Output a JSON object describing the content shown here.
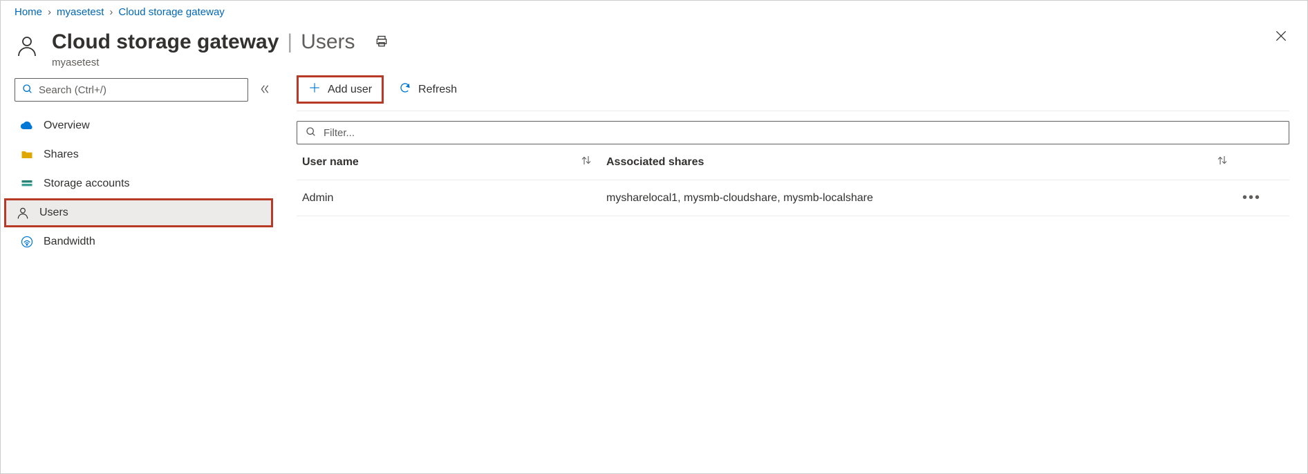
{
  "breadcrumb": [
    {
      "label": "Home"
    },
    {
      "label": "myasetest"
    },
    {
      "label": "Cloud storage gateway"
    }
  ],
  "header": {
    "title": "Cloud storage gateway",
    "section": "Users",
    "subtitle": "myasetest"
  },
  "sidebar": {
    "search_placeholder": "Search (Ctrl+/)",
    "items": [
      {
        "label": "Overview",
        "icon": "cloud"
      },
      {
        "label": "Shares",
        "icon": "folder"
      },
      {
        "label": "Storage accounts",
        "icon": "storage"
      },
      {
        "label": "Users",
        "icon": "user",
        "selected": true
      },
      {
        "label": "Bandwidth",
        "icon": "wifi"
      }
    ]
  },
  "toolbar": {
    "add_user": "Add user",
    "refresh": "Refresh"
  },
  "filter": {
    "placeholder": "Filter..."
  },
  "table": {
    "columns": {
      "user": "User name",
      "shares": "Associated shares"
    },
    "rows": [
      {
        "user": "Admin",
        "shares": "mysharelocal1, mysmb-cloudshare, mysmb-localshare"
      }
    ]
  }
}
